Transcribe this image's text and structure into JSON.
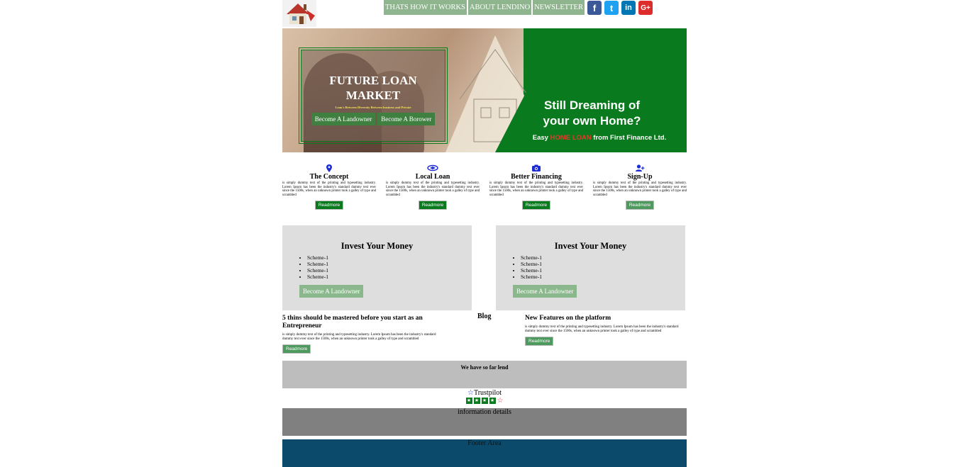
{
  "nav": {
    "items": [
      {
        "label": "THATS HOW IT WORKS"
      },
      {
        "label": "ABOUT LENDINO"
      },
      {
        "label": "NEWSLETTER"
      }
    ]
  },
  "social": {
    "facebook": "f",
    "twitter": "t",
    "linkedin": "in",
    "google": "G+"
  },
  "hero": {
    "title": "FUTURE LOAN MARKET",
    "subtitle": "Loan's Between Diversity Between business and Private",
    "btn_landowner": "Become A Landowner",
    "btn_borower": "Become A Borower",
    "tag_line1": "Still Dreaming of",
    "tag_line2": "your own Home?",
    "tag_easy": "Easy",
    "tag_home_loan": "HOME LOAN",
    "tag_from": "from First Finance Ltd."
  },
  "features": [
    {
      "icon": "map-marker-icon",
      "title": "The Concept",
      "text": "is simply dummy text of the printing and typesetting industry. Lorem Ipsum has been the industry's standard dummy text ever since the 1500s, when an unknown printer took a galley of type and scrambled",
      "button": "Readmore"
    },
    {
      "icon": "handshake-icon",
      "title": "Local Loan",
      "text": "is simply dummy text of the printing and typesetting industry. Lorem Ipsum has been the industry's standard dummy text ever since the 1500s, when an unknown printer took a galley of type and scrambled",
      "button": "Readmore"
    },
    {
      "icon": "camera-icon",
      "title": "Better Financing",
      "text": "is simply dummy text of the printing and typesetting industry. Lorem Ipsum has been the industry's standard dummy text ever since the 1500s, when an unknown printer took a galley of type and scrambled",
      "button": "Readmore"
    },
    {
      "icon": "user-plus-icon",
      "title": "Sign-Up",
      "text": "is simply dummy text of the printing and typesetting industry. Lorem Ipsum has been the industry's standard dummy text ever since the 1500s, when an unknown printer took a galley of type and scrambled",
      "button": "Readmore"
    }
  ],
  "invest": [
    {
      "title": "Invest Your Money",
      "items": [
        "Scheme-1",
        "Scheme-1",
        "Scheme-1",
        "Scheme-1"
      ],
      "button": "Become A Landowner"
    },
    {
      "title": "Invest Your Money",
      "items": [
        "Scheme-1",
        "Scheme-1",
        "Scheme-1",
        "Scheme-1"
      ],
      "button": "Become A Landowner"
    }
  ],
  "blog": {
    "label": "Blog",
    "left": {
      "title": "5 thins should be mastered before you start as an Entrepreneur",
      "text": "is simply dummy text of the printing and typesetting industry. Lorem Ipsum has been the industry's standard dummy text ever since the 1500s, when an unknown printer took a galley of type and scrambled",
      "button": "Readmore"
    },
    "right": {
      "title": "New Features on the platform",
      "text": "is simply dummy text of the printing and typesetting industry. Lorem Ipsum has been the industry's standard dummy text ever since the 1500s, when an unknown printer took a galley of type and scrambled",
      "button": "Readmore"
    }
  },
  "band_lend": "We have so far lend",
  "trustpilot": {
    "label": "Trustpilot",
    "rating_stars": 4,
    "max_stars": 5
  },
  "info": "information details",
  "footer": "Footer Area",
  "colors": {
    "green": "#0a7a1e",
    "nav": "#8fb58f",
    "footer": "#0b4a6b"
  }
}
